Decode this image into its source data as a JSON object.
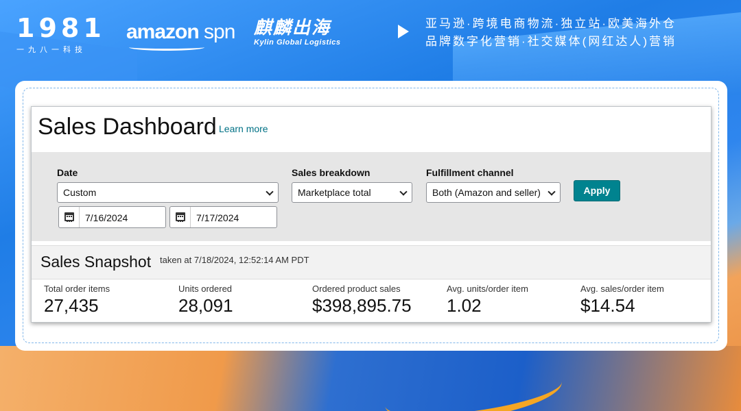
{
  "header": {
    "logo_1981": "1981",
    "logo_1981_sub": "一九八一科技",
    "logo_amazon": "amazon",
    "logo_amazon_spn": "spn",
    "logo_kylin_cn": "麒麟出海",
    "logo_kylin_en": "Kylin Global Logistics",
    "tagline_line1": "亚马逊·跨境电商物流·独立站·欧美海外仓",
    "tagline_line2": "品牌数字化营销·社交媒体(网红达人)营销"
  },
  "dashboard": {
    "title": "Sales Dashboard",
    "learn_more": "Learn more",
    "filters": {
      "date_label": "Date",
      "date_value": "Custom",
      "start_date": "7/16/2024",
      "end_date": "7/17/2024",
      "breakdown_label": "Sales breakdown",
      "breakdown_value": "Marketplace total",
      "fulfillment_label": "Fulfillment channel",
      "fulfillment_value": "Both (Amazon and seller)",
      "apply_label": "Apply"
    },
    "snapshot": {
      "title": "Sales Snapshot",
      "taken": "taken at 7/18/2024, 12:52:14 AM PDT",
      "metrics": [
        {
          "label": "Total order items",
          "value": "27,435"
        },
        {
          "label": "Units ordered",
          "value": "28,091"
        },
        {
          "label": "Ordered product sales",
          "value": "$398,895.75"
        },
        {
          "label": "Avg. units/order item",
          "value": "1.02"
        },
        {
          "label": "Avg. sales/order item",
          "value": "$14.54"
        }
      ]
    }
  },
  "colors": {
    "apply_button": "#00838f",
    "link": "#007185",
    "filter_bg": "#e6e6e6"
  },
  "icons": [
    "calendar-icon",
    "chevron-down-icon",
    "play-icon"
  ]
}
